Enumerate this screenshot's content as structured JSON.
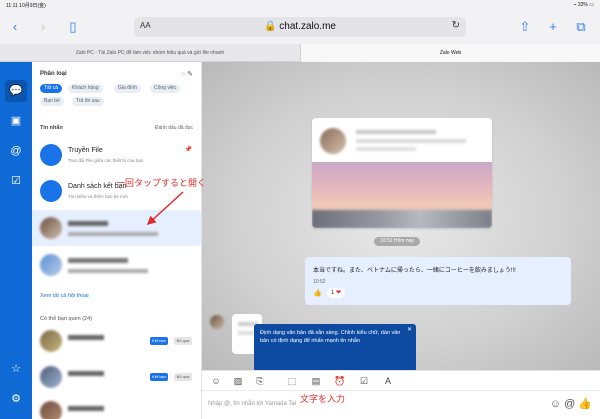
{
  "status_bar": {
    "time": "11:11",
    "date": "10月9日(金)",
    "battery": "33%"
  },
  "browser": {
    "text_size_label": "AA",
    "url": "chat.zalo.me",
    "tabs": [
      {
        "label": "Zalo PC - Tải Zalo PC để làm việc nhóm hiệu quả và gửi file nhanh"
      },
      {
        "label": "Zalo Web"
      }
    ]
  },
  "chat_list": {
    "category_title": "Phân loại",
    "filters": [
      "Tất cả",
      "Khách hàng",
      "Gia đình",
      "Công việc",
      "Bạn bè",
      "Trả lời sau"
    ],
    "messages_header": "Tin nhắn",
    "messages_side": "Đánh dấu đã đọc",
    "conversations": [
      {
        "name": "Truyền File",
        "subtitle": "Trao đổi File giữa các thiết bị của bạn"
      },
      {
        "name": "Danh sách kết bạn",
        "subtitle": "Tìm kiếm và thêm bạn bè mới"
      },
      {
        "name": "",
        "subtitle": ""
      },
      {
        "name": "",
        "subtitle": ""
      }
    ],
    "see_all": "Xem tất cả hội thoại",
    "suggest_header": "Có thể bạn quen (24)",
    "add_label": "Kết bạn",
    "skip_label": "Bỏ qua"
  },
  "chat": {
    "time_divider": "10:52 Hôm nay",
    "my_message": "本当ですね。また、ベトナムに帰ったら、一緒にコーヒーを飲みましょう!!!",
    "my_message_time": "10:52",
    "reaction_count": "1",
    "tooltip": "Định dạng văn bản đã sẵn sàng. Chỉnh kiểu chữ, dàn văn bản có định dạng để nhấn mạnh tin nhắn",
    "composer_placeholder": "Nhập @, tin nhắn tới Yamada Tai",
    "like_icon": "thumbs-up-icon"
  },
  "annotations": {
    "tap": "一回タップすると開く",
    "type": "文字を入力"
  },
  "colors": {
    "zalo_blue": "#0f6ad6",
    "annotation_red": "#e12a2a",
    "tooltip": "#0d4aa1"
  }
}
